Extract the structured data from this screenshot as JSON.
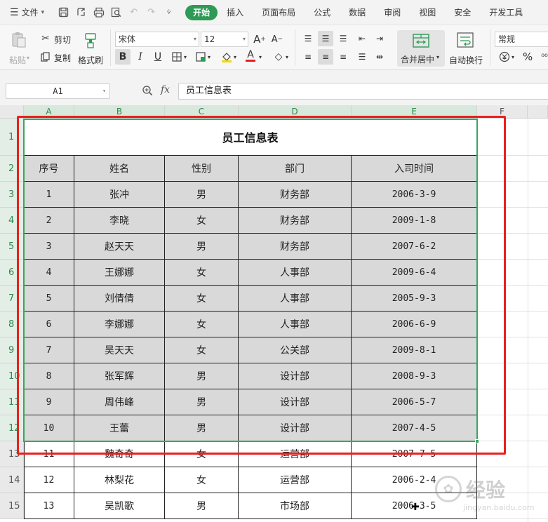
{
  "menu": {
    "file_label": "文件",
    "tabs": [
      "开始",
      "插入",
      "页面布局",
      "公式",
      "数据",
      "审阅",
      "视图",
      "安全",
      "开发工具"
    ],
    "active_tab": "开始",
    "accent": "#2e9a55"
  },
  "ribbon": {
    "paste": "粘贴",
    "cut": "剪切",
    "copy": "复制",
    "format_painter": "格式刷",
    "font_name": "宋体",
    "font_size": "12",
    "merge_center": "合并居中",
    "wrap_text": "自动换行",
    "number_format": "常规"
  },
  "formula_bar": {
    "cell_ref": "A1",
    "fx_label": "fx",
    "content": "员工信息表"
  },
  "sheet": {
    "columns": [
      "A",
      "B",
      "C",
      "D",
      "E",
      "F"
    ],
    "rows": [
      "1",
      "2",
      "3",
      "4",
      "5",
      "6",
      "7",
      "8",
      "9",
      "10",
      "11",
      "12",
      "13",
      "14",
      "15"
    ],
    "title": "员工信息表",
    "headers": [
      "序号",
      "姓名",
      "性别",
      "部门",
      "入司时间"
    ],
    "records": [
      [
        "1",
        "张冲",
        "男",
        "财务部",
        "2006-3-9"
      ],
      [
        "2",
        "李晓",
        "女",
        "财务部",
        "2009-1-8"
      ],
      [
        "3",
        "赵天天",
        "男",
        "财务部",
        "2007-6-2"
      ],
      [
        "4",
        "王娜娜",
        "女",
        "人事部",
        "2009-6-4"
      ],
      [
        "5",
        "刘倩倩",
        "女",
        "人事部",
        "2005-9-3"
      ],
      [
        "6",
        "李娜娜",
        "女",
        "人事部",
        "2006-6-9"
      ],
      [
        "7",
        "吴天天",
        "女",
        "公关部",
        "2009-8-1"
      ],
      [
        "8",
        "张军辉",
        "男",
        "设计部",
        "2008-9-3"
      ],
      [
        "9",
        "周伟峰",
        "男",
        "设计部",
        "2006-5-7"
      ],
      [
        "10",
        "王蕾",
        "男",
        "设计部",
        "2007-4-5"
      ],
      [
        "11",
        "魏奇奇",
        "女",
        "运营部",
        "2007-7-5"
      ],
      [
        "12",
        "林梨花",
        "女",
        "运营部",
        "2006-2-4"
      ],
      [
        "13",
        "吴凯歌",
        "男",
        "市场部",
        "2006-3-5"
      ]
    ],
    "selected_rows": 12,
    "selection_color": "#3fa45f",
    "highlight_color": "#e8201e"
  },
  "watermark": {
    "text": "经验",
    "sub": "jingyan.baidu.com"
  }
}
